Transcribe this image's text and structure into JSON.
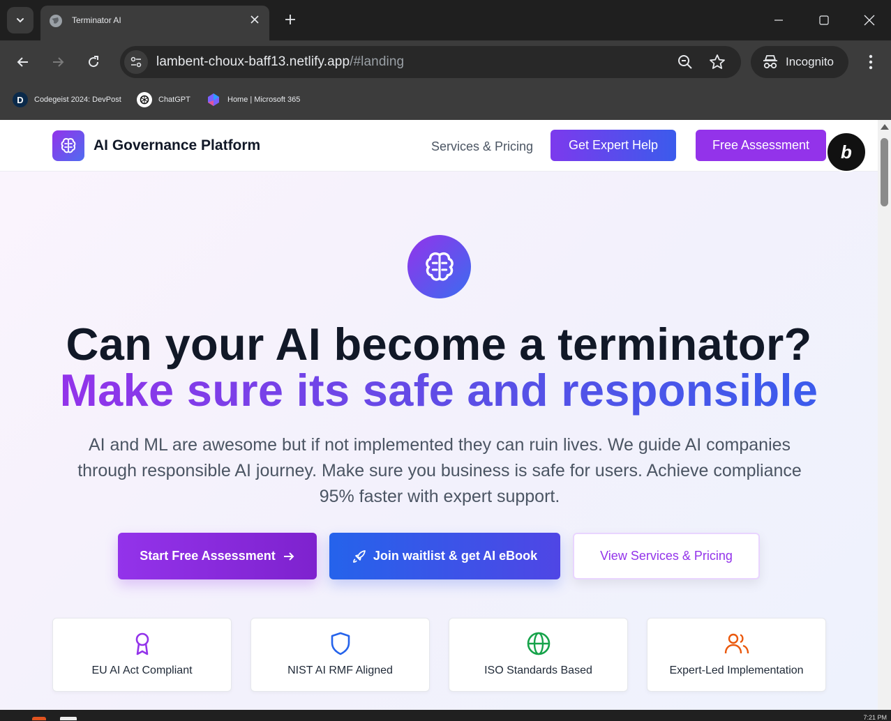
{
  "browser": {
    "tab_title": "Terminator AI",
    "url_host": "lambent-choux-baff13.netlify.app",
    "url_path": "/#landing",
    "incognito_label": "Incognito",
    "bookmarks": [
      {
        "label": "Codegeist 2024: DevPost",
        "icon": "D"
      },
      {
        "label": "ChatGPT",
        "icon": "chatgpt-icon"
      },
      {
        "label": "Home | Microsoft 365",
        "icon": "microsoft365-icon"
      }
    ]
  },
  "navbar": {
    "brand": "AI Governance Platform",
    "services_link": "Services & Pricing",
    "expert_button": "Get Expert Help",
    "free_button": "Free Assessment",
    "bolt_badge": "b"
  },
  "hero": {
    "headline_line1": "Can your AI become a terminator?",
    "headline_line2": "Make sure its safe and responsible",
    "subtext": "AI and ML are awesome but if not implemented they can ruin lives. We guide AI companies through responsible AI journey. Make sure you business is safe for users. Achieve compliance 95% faster with expert support.",
    "cta_start": "Start Free Assessment",
    "cta_waitlist": "Join waitlist & get AI eBook",
    "cta_view": "View Services & Pricing"
  },
  "features": [
    {
      "label": "EU AI Act Compliant",
      "icon": "award-icon",
      "color": "#9333ea"
    },
    {
      "label": "NIST AI RMF Aligned",
      "icon": "shield-icon",
      "color": "#2563eb"
    },
    {
      "label": "ISO Standards Based",
      "icon": "globe-icon",
      "color": "#16a34a"
    },
    {
      "label": "Expert-Led Implementation",
      "icon": "users-icon",
      "color": "#ea580c"
    }
  ],
  "taskbar": {
    "time": "7:21 PM"
  }
}
